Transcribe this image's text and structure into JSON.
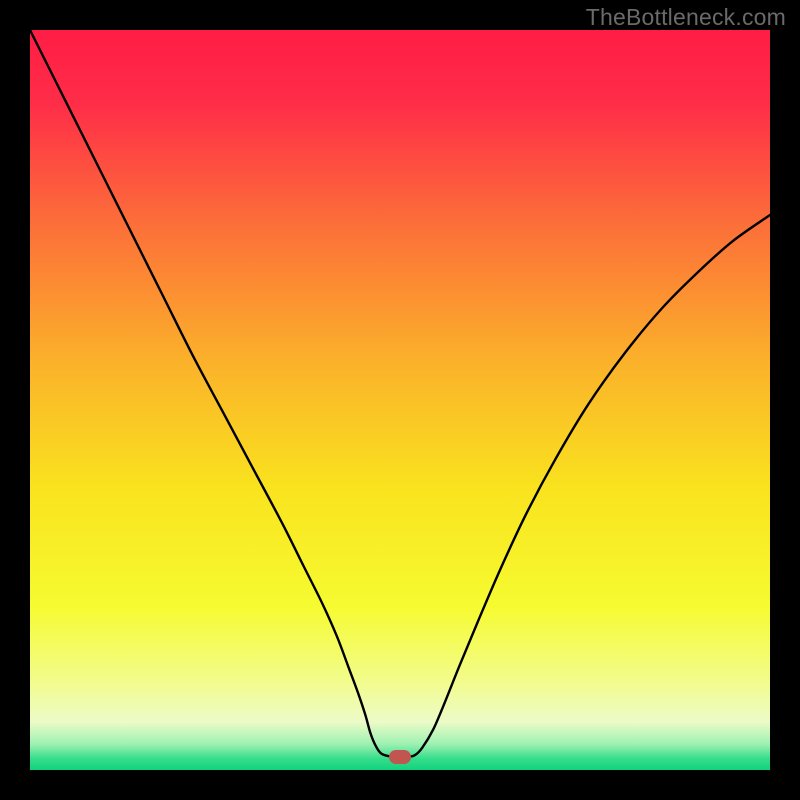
{
  "watermark": "TheBottleneck.com",
  "chart_data": {
    "type": "line",
    "title": "",
    "xlabel": "",
    "ylabel": "",
    "xlim": [
      0,
      100
    ],
    "ylim": [
      0,
      100
    ],
    "grid": false,
    "background": {
      "type": "vertical-gradient",
      "stops": [
        {
          "pos": 0.0,
          "color": "#ff1d45"
        },
        {
          "pos": 0.1,
          "color": "#ff2d48"
        },
        {
          "pos": 0.25,
          "color": "#fc6a3a"
        },
        {
          "pos": 0.45,
          "color": "#fbb22a"
        },
        {
          "pos": 0.62,
          "color": "#f9e31e"
        },
        {
          "pos": 0.78,
          "color": "#f6fb31"
        },
        {
          "pos": 0.88,
          "color": "#f2fc8c"
        },
        {
          "pos": 0.935,
          "color": "#ecfbc8"
        },
        {
          "pos": 0.965,
          "color": "#9ef1b2"
        },
        {
          "pos": 0.985,
          "color": "#34dd8a"
        },
        {
          "pos": 1.0,
          "color": "#11d37e"
        }
      ]
    },
    "series": [
      {
        "name": "bottleneck-curve",
        "color": "#000000",
        "stroke_width": 2.4,
        "x": [
          0.0,
          3.0,
          6.5,
          10.0,
          14.0,
          18.0,
          22.0,
          26.0,
          30.0,
          34.0,
          37.0,
          39.5,
          41.5,
          43.0,
          44.3,
          45.3,
          46.0,
          46.7,
          47.5,
          49.0,
          51.0,
          52.0,
          53.0,
          54.5,
          56.0,
          58.0,
          60.5,
          63.5,
          67.0,
          71.0,
          75.5,
          80.5,
          85.5,
          90.5,
          95.0,
          100.0
        ],
        "y": [
          100.0,
          94.0,
          87.0,
          80.0,
          72.0,
          64.0,
          56.0,
          48.5,
          41.0,
          33.5,
          27.5,
          22.5,
          18.0,
          14.0,
          10.5,
          7.5,
          5.0,
          3.3,
          2.2,
          1.8,
          1.8,
          2.0,
          3.0,
          5.5,
          9.0,
          14.0,
          20.0,
          27.0,
          34.5,
          42.0,
          49.5,
          56.5,
          62.5,
          67.5,
          71.5,
          75.0
        ]
      }
    ],
    "marker": {
      "name": "optimal-point",
      "x": 50.0,
      "y": 1.8,
      "color": "#c1554f",
      "shape": "rounded-rect"
    }
  }
}
